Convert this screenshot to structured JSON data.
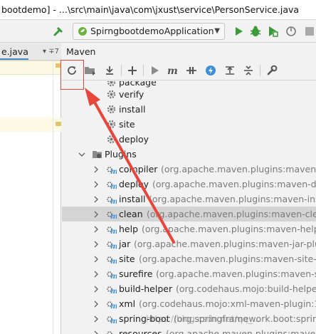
{
  "window": {
    "title": "bootdemo] - ...\\src\\main\\java\\com\\jxust\\service\\PersonService.java"
  },
  "run_toolbar": {
    "config_name": "SpirngbootdemoApplication",
    "icons": [
      "hammer-icon",
      "spring-boot-icon",
      "dropdown-icon",
      "run-icon",
      "debug-icon",
      "coverage-icon",
      "stop-icon"
    ]
  },
  "editor_tabs": {
    "active_label": "e.java",
    "menu_label": "▾ ∓7"
  },
  "maven": {
    "title": "Maven",
    "toolbar": [
      "reload-icon",
      "add-folder-icon",
      "download-icon",
      "add-icon",
      "run-goal-icon",
      "execute-maven-icon",
      "toggle-offline-icon",
      "skip-tests-icon",
      "show-dependencies-icon",
      "collapse-all-icon",
      "settings-wrench-icon"
    ],
    "partial_item": "package",
    "lifecycle": [
      "verify",
      "install",
      "site",
      "deploy"
    ],
    "plugins_label": "Plugins",
    "plugins": [
      {
        "name": "compiler",
        "detail": "(org.apache.maven.plugins:maven-compiler"
      },
      {
        "name": "deploy",
        "detail": "(org.apache.maven.plugins:maven-deploy"
      },
      {
        "name": "install",
        "detail": "(org.apache.maven.plugins:maven-install-"
      },
      {
        "name": "clean",
        "detail": "(org.apache.maven.plugins:maven-clean-pl",
        "selected": true
      },
      {
        "name": "help",
        "detail": "(org.apache.maven.plugins:maven-help-plu"
      },
      {
        "name": "jar",
        "detail": "(org.apache.maven.plugins:maven-jar-plugin"
      },
      {
        "name": "site",
        "detail": "(org.apache.maven.plugins:maven-site-plugi"
      },
      {
        "name": "surefire",
        "detail": "(org.apache.maven.plugins:maven-suref"
      },
      {
        "name": "build-helper",
        "detail": "(org.codehaus.mojo:build-helper-m"
      },
      {
        "name": "xml",
        "detail": "(org.codehaus.mojo:xml-maven-plugin:1.0)"
      },
      {
        "name": "spring-boot",
        "detail": "(org.springframework.boot:spring-"
      },
      {
        "name": "resources",
        "detail": "(org.apache.maven.plugins:maven-"
      }
    ]
  },
  "watermark": "https://blog.csdn.net/qq_...",
  "colors": {
    "annotation_red": "#e8453c",
    "run_green": "#3c9a3a",
    "maven_blue": "#3d8fd6",
    "selection": "#d4d4d4"
  }
}
